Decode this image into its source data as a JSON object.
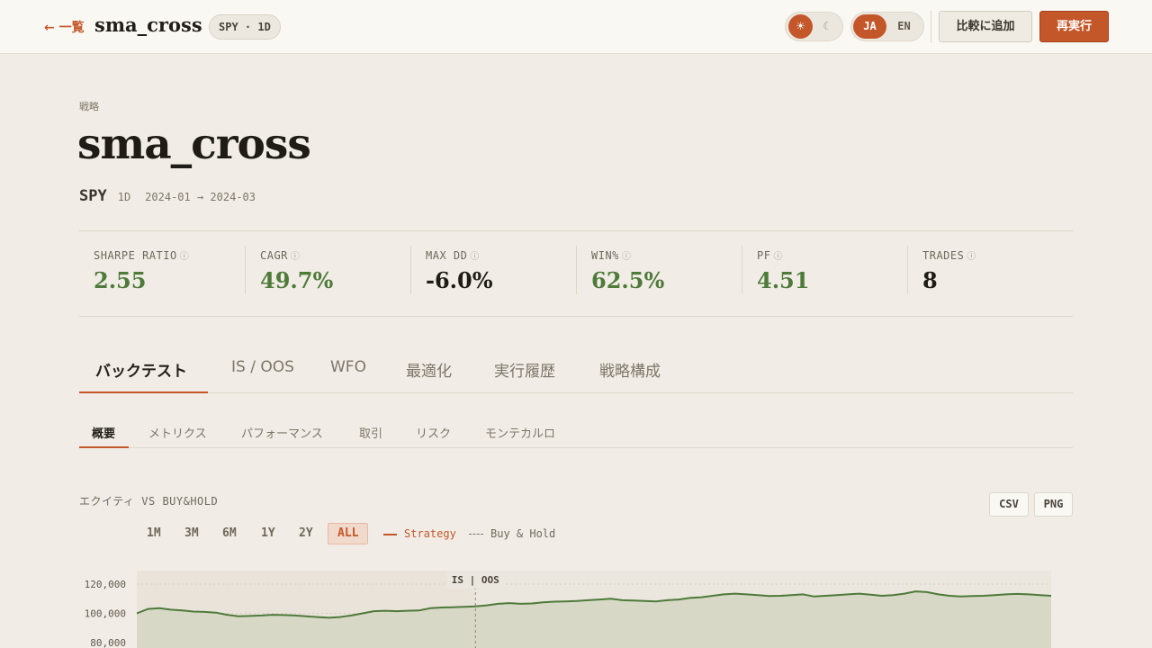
{
  "header": {
    "back_label": "← 一覧",
    "app_title": "sma_cross",
    "context_pill": "SPY · 1D",
    "theme": {
      "light_icon": "☀",
      "dark_icon": "☾",
      "active": "light"
    },
    "lang": {
      "ja": "JA",
      "en": "EN",
      "active": "JA"
    },
    "compare_label": "比較に追加",
    "rerun_label": "再実行",
    "colors": {
      "accent": "#c4572a"
    }
  },
  "hero": {
    "eyebrow": "戦略",
    "title": "sma_cross",
    "symbol": "SPY",
    "timeframe": "1D",
    "date_range": "2024-01 → 2024-03"
  },
  "metrics": [
    {
      "label": "SHARPE RATIO",
      "value": "2.55",
      "tone": "positive"
    },
    {
      "label": "CAGR",
      "value": "49.7%",
      "tone": "positive"
    },
    {
      "label": "MAX DD",
      "value": "-6.0%",
      "tone": "neutral"
    },
    {
      "label": "WIN%",
      "value": "62.5%",
      "tone": "positive"
    },
    {
      "label": "PF",
      "value": "4.51",
      "tone": "positive"
    },
    {
      "label": "TRADES",
      "value": "8",
      "tone": "neutral"
    }
  ],
  "metric_info_icon": "ⓘ",
  "tone_colors": {
    "positive": "#4e7a3a",
    "neutral": "#1f1b16"
  },
  "tabs": [
    {
      "label": "バックテスト",
      "active": true
    },
    {
      "label": "IS / OOS"
    },
    {
      "label": "WFO"
    },
    {
      "label": "最適化"
    },
    {
      "label": "実行履歴"
    },
    {
      "label": "戦略構成"
    }
  ],
  "subtabs": [
    {
      "label": "概要",
      "active": true
    },
    {
      "label": "メトリクス"
    },
    {
      "label": "パフォーマンス"
    },
    {
      "label": "取引"
    },
    {
      "label": "リスク"
    },
    {
      "label": "モンテカルロ"
    }
  ],
  "equity_section": {
    "title": "エクイティ VS BUY&HOLD",
    "export": [
      "CSV",
      "PNG"
    ],
    "ranges": [
      "1M",
      "3M",
      "6M",
      "1Y",
      "2Y",
      "ALL"
    ],
    "active_range": "ALL",
    "legend": [
      {
        "name": "Strategy",
        "color": "#c4572a",
        "style": "solid"
      },
      {
        "name": "Buy & Hold",
        "color": "#7d7568",
        "style": "dashed"
      }
    ]
  },
  "chart_data": {
    "type": "area",
    "y_ticks": [
      "120,000",
      "100,000",
      "80,000"
    ],
    "y_tick_values": [
      120000,
      100000,
      80000
    ],
    "split_label": "IS | OOS",
    "split_index": 30,
    "line_color": "#4e7a3a",
    "series": [
      {
        "values": [
          100000,
          103000,
          103500,
          102500,
          102000,
          101200,
          101000,
          100500,
          99000,
          98000,
          98200,
          98500,
          99000,
          98800,
          98500,
          98000,
          97500,
          97000,
          97500,
          98500,
          100000,
          101500,
          101800,
          101500,
          101800,
          102000,
          103500,
          104000,
          104200,
          104500,
          104800,
          105500,
          106500,
          107000,
          106500,
          106800,
          107500,
          108000,
          108200,
          108500,
          109000,
          109500,
          110000,
          109000,
          108800,
          108500,
          108200,
          109000,
          109500,
          110500,
          111000,
          112000,
          113000,
          113500,
          113000,
          112500,
          111800,
          112000,
          112500,
          113000,
          111500,
          112000,
          112500,
          113000,
          113500,
          112800,
          112000,
          112500,
          113500,
          115000,
          114500,
          113000,
          112000,
          111500,
          111800,
          112000,
          112500,
          113000,
          113300,
          113000,
          112500,
          112000
        ]
      }
    ]
  }
}
